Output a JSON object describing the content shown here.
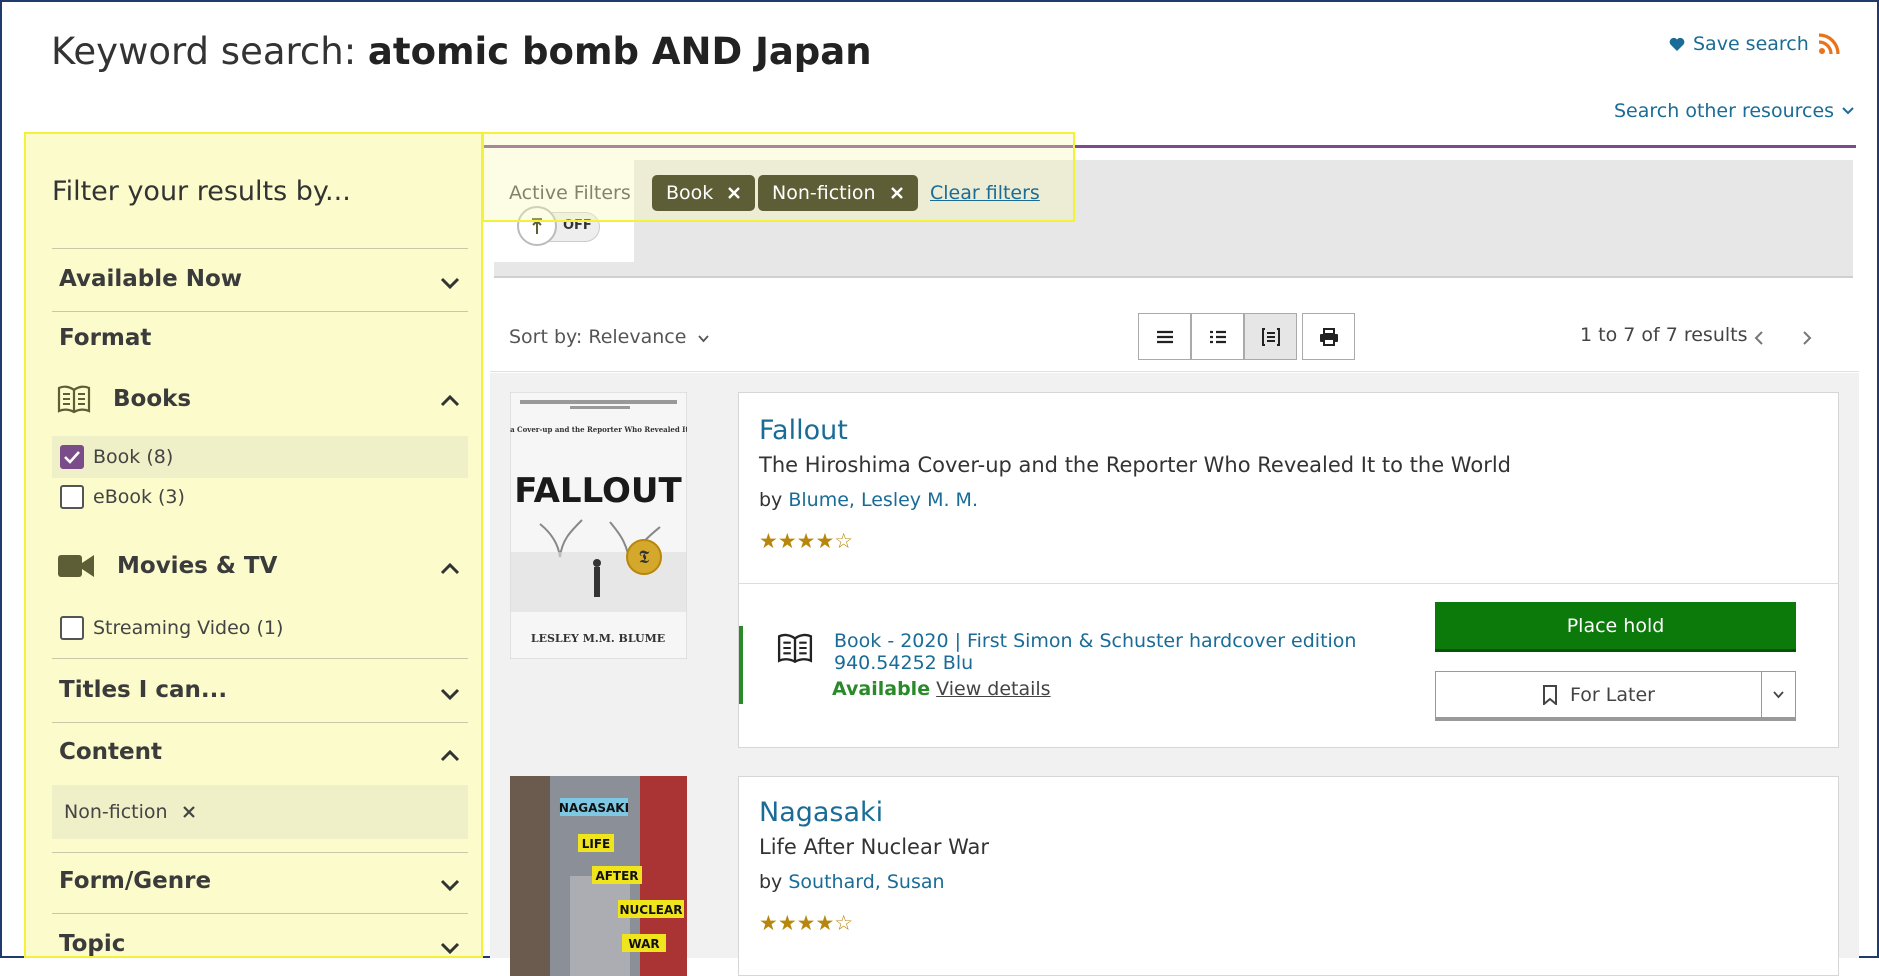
{
  "header": {
    "title_prefix": "Keyword search: ",
    "title_query": "atomic bomb AND Japan",
    "save_search": "Save search",
    "other_resources": "Search other resources"
  },
  "sidebar": {
    "heading": "Filter your results by...",
    "available_now": "Available Now",
    "format_label": "Format",
    "books_group": "Books",
    "book_item": "Book (8)",
    "ebook_item": "eBook (3)",
    "movies_group": "Movies & TV",
    "streaming_item": "Streaming Video (1)",
    "titles_i_can": "Titles I can...",
    "content_label": "Content",
    "content_chip": "Non-fiction",
    "form_genre": "Form/Genre",
    "topic": "Topic"
  },
  "active_filters": {
    "label": "Active Filters",
    "toggle_state": "OFF",
    "chips": [
      "Book",
      "Non-fiction"
    ],
    "clear": "Clear filters"
  },
  "toolbar": {
    "sort": "Sort by: Relevance",
    "count": "1 to 7 of 7 results"
  },
  "results": [
    {
      "title": "Fallout",
      "subtitle": "The Hiroshima Cover-up and the Reporter Who Revealed It to the World",
      "by": "by ",
      "author": "Blume, Lesley M. M.",
      "stars": "★★★★☆",
      "rating": 4,
      "cover_top": "The Hiroshima Cover-up and the Reporter Who Revealed It to the World",
      "cover_word": "FALLOUT",
      "cover_author": "LESLEY M.M. BLUME",
      "edition": "Book - 2020 | First Simon & Schuster hardcover edition",
      "call_number": "940.54252 Blu",
      "available": "Available",
      "view_details": "View details",
      "place_hold": "Place hold",
      "for_later": "For Later"
    },
    {
      "title": "Nagasaki",
      "subtitle": "Life After Nuclear War",
      "by": "by ",
      "author": "Southard, Susan",
      "stars": "★★★★☆",
      "rating": 4,
      "cover_words": [
        "NAGASAKI",
        "LIFE",
        "AFTER",
        "NUCLEAR",
        "WAR"
      ]
    }
  ],
  "colors": {
    "accent_purple": "#7a4c8a",
    "link_blue": "#1a6c97",
    "hold_green": "#0b7a0b",
    "chip_olive": "#5d5d36",
    "highlight_yellow": "#f2f23a"
  }
}
